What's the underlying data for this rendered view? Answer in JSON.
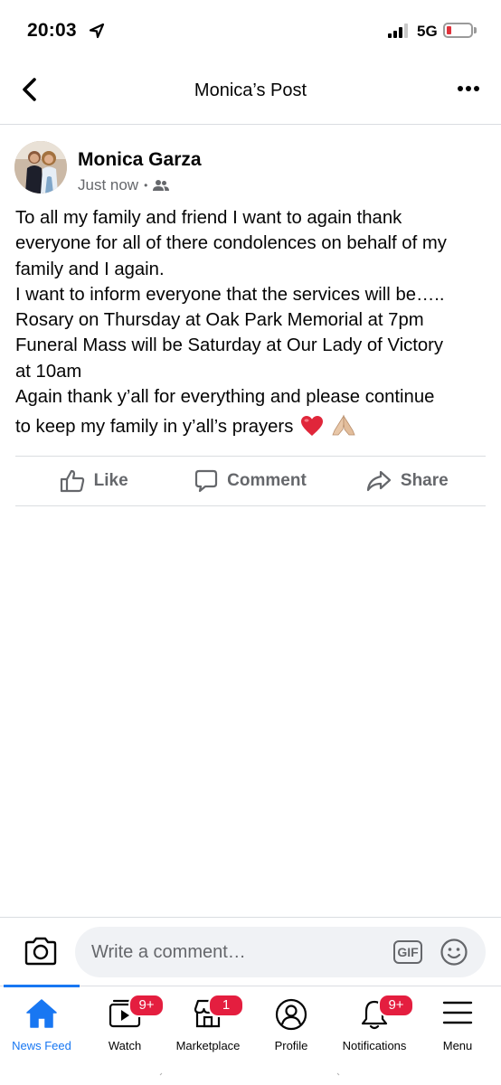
{
  "status_bar": {
    "time": "20:03",
    "network": "5G"
  },
  "nav": {
    "title": "Monica’s Post"
  },
  "post": {
    "author": "Monica Garza",
    "timestamp": "Just now",
    "lines": [
      "To all my family and friend I want to again thank",
      "everyone for all of there condolences on behalf of my",
      "family and I again.",
      "I want to inform everyone that the services will be…..",
      "Rosary on Thursday at Oak Park Memorial at 7pm",
      "Funeral Mass will be Saturday at Our Lady of Victory",
      "at 10am",
      "Again thank y’all for everything and please continue",
      "to keep my family in y’all’s prayers"
    ],
    "actions": {
      "like": "Like",
      "comment": "Comment",
      "share": "Share"
    }
  },
  "comment_bar": {
    "placeholder": "Write a comment…",
    "gif": "GIF"
  },
  "tabs": [
    {
      "label": "News Feed",
      "badge": ""
    },
    {
      "label": "Watch",
      "badge": "9+"
    },
    {
      "label": "Marketplace",
      "badge": "1"
    },
    {
      "label": "Profile",
      "badge": ""
    },
    {
      "label": "Notifications",
      "badge": "9+"
    },
    {
      "label": "Menu",
      "badge": ""
    }
  ],
  "colors": {
    "accent": "#1877f2",
    "badge": "#e41e3f",
    "secondary_text": "#65676b",
    "divider": "#dadde1"
  },
  "icons": [
    "location-arrow-icon",
    "back-chevron-icon",
    "more-dots-icon",
    "friends-audience-icon",
    "like-thumb-icon",
    "comment-bubble-icon",
    "share-arrow-icon",
    "camera-icon",
    "gif-icon",
    "emoji-smile-icon",
    "home-icon",
    "watch-icon",
    "marketplace-icon",
    "profile-icon",
    "bell-icon",
    "menu-icon",
    "red-heart-emoji",
    "praying-hands-emoji"
  ]
}
